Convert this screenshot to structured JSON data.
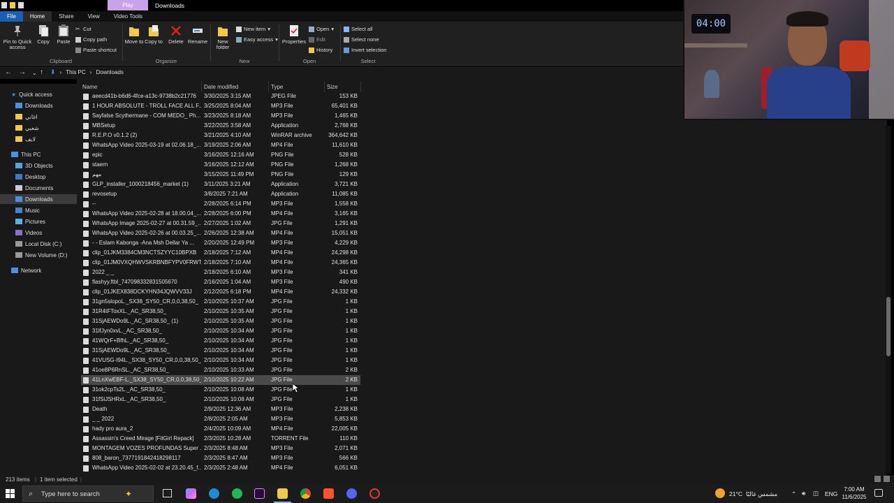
{
  "title_bar": {
    "context_tab": "Play",
    "window_title": "Downloads"
  },
  "ribbon_tabs": [
    "File",
    "Home",
    "Share",
    "View",
    "Video Tools"
  ],
  "ribbon": {
    "clipboard": {
      "pin_label": "Pin to Quick access",
      "copy_label": "Copy",
      "paste_label": "Paste",
      "cut_label": "Cut",
      "copy_path_label": "Copy path",
      "paste_shortcut_label": "Paste shortcut",
      "group_label": "Clipboard"
    },
    "organize": {
      "move_to_label": "Move to",
      "copy_to_label": "Copy to",
      "delete_label": "Delete",
      "rename_label": "Rename",
      "group_label": "Organize"
    },
    "new": {
      "new_folder_label": "New folder",
      "new_item_label": "New item",
      "easy_access_label": "Easy access",
      "group_label": "New"
    },
    "open": {
      "properties_label": "Properties",
      "open_label": "Open",
      "edit_label": "Edit",
      "history_label": "History",
      "group_label": "Open"
    },
    "select": {
      "select_all_label": "Select all",
      "select_none_label": "Select none",
      "invert_label": "Invert selection",
      "group_label": "Select"
    }
  },
  "address": {
    "crumbs": [
      "This PC",
      "Downloads"
    ]
  },
  "nav_pane": {
    "quick_access": "Quick access",
    "quick_items": [
      "Downloads",
      "اغاني",
      "شعبي",
      "لايف"
    ],
    "this_pc": "This PC",
    "pc_items": [
      "3D Objects",
      "Desktop",
      "Documents",
      "Downloads",
      "Music",
      "Pictures",
      "Videos",
      "Local Disk (C:)",
      "New Volume (D:)"
    ],
    "network": "Network"
  },
  "columns": {
    "name": "Name",
    "date": "Date modified",
    "type": "Type",
    "size": "Size"
  },
  "files": [
    {
      "name": "aeecd41b-b6d6-4fce-a13c-9738b2c21776",
      "date": "3/30/2025 3:15 AM",
      "type": "JPEG File",
      "size": "153 KB"
    },
    {
      "name": "1 HOUR ABSOLUTE - TROLL FACE  ALL F...",
      "date": "3/25/2025 8:04 AM",
      "type": "MP3 File",
      "size": "65,401 KB"
    },
    {
      "name": "Sayfalse Scythermane - COM MEDO_ Ph...",
      "date": "3/23/2025 8:18 AM",
      "type": "MP3 File",
      "size": "1,465 KB"
    },
    {
      "name": "MBSetup",
      "date": "3/22/2025 3:58 AM",
      "type": "Application",
      "size": "2,768 KB"
    },
    {
      "name": "R.E.P.O v0.1.2 (2)",
      "date": "3/21/2025 4:10 AM",
      "type": "WinRAR archive",
      "size": "364,642 KB"
    },
    {
      "name": "WhatsApp Video 2025-03-19 at 02.06.18_...",
      "date": "3/19/2025 2:06 AM",
      "type": "MP4 File",
      "size": "11,610 KB"
    },
    {
      "name": "epic",
      "date": "3/16/2025 12:16 AM",
      "type": "PNG File",
      "size": "528 KB"
    },
    {
      "name": "staern",
      "date": "3/16/2025 12:12 AM",
      "type": "PNG File",
      "size": "1,268 KB"
    },
    {
      "name": "مهم",
      "date": "3/15/2025 11:49 PM",
      "type": "PNG File",
      "size": "129 KB"
    },
    {
      "name": "GLP_installer_1000218456_market (1)",
      "date": "3/11/2025 3:21 AM",
      "type": "Application",
      "size": "3,721 KB"
    },
    {
      "name": "revosetup",
      "date": "3/8/2025 7:21 AM",
      "type": "Application",
      "size": "11,085 KB"
    },
    {
      "name": "--",
      "date": "2/28/2025 6:14 PM",
      "type": "MP3 File",
      "size": "1,558 KB"
    },
    {
      "name": "WhatsApp Video 2025-02-28 at 18.00.04_...",
      "date": "2/28/2025 6:00 PM",
      "type": "MP4 File",
      "size": "3,165 KB"
    },
    {
      "name": "WhatsApp Image 2025-02-27 at 00.31.59_...",
      "date": "2/27/2025 1:02 AM",
      "type": "JPG File",
      "size": "1,291 KB"
    },
    {
      "name": "WhatsApp Video 2025-02-26 at 00.03.25_...",
      "date": "2/26/2025 12:38 AM",
      "type": "MP4 File",
      "size": "15,051 KB"
    },
    {
      "name": "-  - Eslam Kabonga -Ana Msh Dellar Ya ...",
      "date": "2/20/2025 12:49 PM",
      "type": "MP3 File",
      "size": "4,229 KB"
    },
    {
      "name": "clip_01JKM3384CM3NCTSZYYC10BPXB",
      "date": "2/18/2025 7:12 AM",
      "type": "MP4 File",
      "size": "24,298 KB"
    },
    {
      "name": "clip_01JM0VXQHWVSKRBNBFYPV0FRWT",
      "date": "2/18/2025 7:10 AM",
      "type": "MP4 File",
      "size": "24,365 KB"
    },
    {
      "name": "2022 _ _",
      "date": "2/18/2025 6:10 AM",
      "type": "MP3 File",
      "size": "341 KB"
    },
    {
      "name": "flashyy.ftbl_747098332831505670",
      "date": "2/16/2025 1:04 AM",
      "type": "MP3 File",
      "size": "490 KB"
    },
    {
      "name": "clip_01JKEX838DCKYHN34JQWVV33J",
      "date": "2/12/2025 6:18 PM",
      "type": "MP4 File",
      "size": "24,332 KB"
    },
    {
      "name": "31gn5slopoL._SX38_SY50_CR,0,0,38,50_",
      "date": "2/10/2025 10:37 AM",
      "type": "JPG File",
      "size": "1 KB"
    },
    {
      "name": "31R4tFToxXL._AC_SR38,50_",
      "date": "2/10/2025 10:35 AM",
      "type": "JPG File",
      "size": "1 KB"
    },
    {
      "name": "31SjAEWDo9L._AC_SR38,50_ (1)",
      "date": "2/10/2025 10:35 AM",
      "type": "JPG File",
      "size": "1 KB"
    },
    {
      "name": "31lfJyn0xvL._AC_SR38,50_",
      "date": "2/10/2025 10:34 AM",
      "type": "JPG File",
      "size": "1 KB"
    },
    {
      "name": "41WQrF+BfhL._AC_SR38,50_",
      "date": "2/10/2025 10:34 AM",
      "type": "JPG File",
      "size": "1 KB"
    },
    {
      "name": "31SjAEWDo9L._AC_SR38,50_",
      "date": "2/10/2025 10:34 AM",
      "type": "JPG File",
      "size": "1 KB"
    },
    {
      "name": "41VUSG-I94L._SX38_SY50_CR,0,0,38,50_",
      "date": "2/10/2025 10:34 AM",
      "type": "JPG File",
      "size": "1 KB"
    },
    {
      "name": "41oe8P6RnSL._AC_SR38,50_",
      "date": "2/10/2025 10:33 AM",
      "type": "JPG File",
      "size": "2 KB"
    },
    {
      "name": "41LnXwEBF-L._SX38_SY50_CR,0,0,38,50_",
      "date": "2/10/2025 10:22 AM",
      "type": "JPG File",
      "size": "2 KB",
      "selected": true
    },
    {
      "name": "31ok2cpTs2L._AC_SR38,50_",
      "date": "2/10/2025 10:08 AM",
      "type": "JPG File",
      "size": "1 KB"
    },
    {
      "name": "31fSiJSHRxL._AC_SR38,50_",
      "date": "2/10/2025 10:08 AM",
      "type": "JPG File",
      "size": "1 KB"
    },
    {
      "name": "Death",
      "date": "2/9/2025 12:36 AM",
      "type": "MP3 File",
      "size": "2,238 KB"
    },
    {
      "name": "_    _ 2022",
      "date": "2/8/2025 2:05 AM",
      "type": "MP3 File",
      "size": "5,853 KB"
    },
    {
      "name": "hady pro aura_2",
      "date": "2/4/2025 10:09 AM",
      "type": "MP4 File",
      "size": "22,005 KB"
    },
    {
      "name": "Assassin's Creed Mirage [FitGirl Repack]",
      "date": "2/3/2025 10:28 AM",
      "type": "TORRENT File",
      "size": "110 KB"
    },
    {
      "name": "MONTAGEM VOZES PROFUNDAS Super ...",
      "date": "2/3/2025 8:48 AM",
      "type": "MP3 File",
      "size": "2,071 KB"
    },
    {
      "name": "808_baron_7377191842418298117",
      "date": "2/3/2025 8:47 AM",
      "type": "MP3 File",
      "size": "566 KB"
    },
    {
      "name": "WhatsApp Video 2025-02-02 at 23.20.45_f...",
      "date": "2/3/2025 2:48 AM",
      "type": "MP4 File",
      "size": "6,051 KB"
    }
  ],
  "status": {
    "items": "213 items",
    "selected": "1 item selected"
  },
  "taskbar": {
    "search_placeholder": "Type here to search",
    "weather": "21°C",
    "weather_desc": "مشمس غالبًا",
    "lang": "ENG",
    "time": "7:00 AM",
    "date": "11/6/2025"
  },
  "webcam": {
    "clock_display": "04:00"
  },
  "colors": {
    "accent": "#1a5fb4",
    "folder": "#f1c94a",
    "context_tab": "#c9a3e8"
  }
}
